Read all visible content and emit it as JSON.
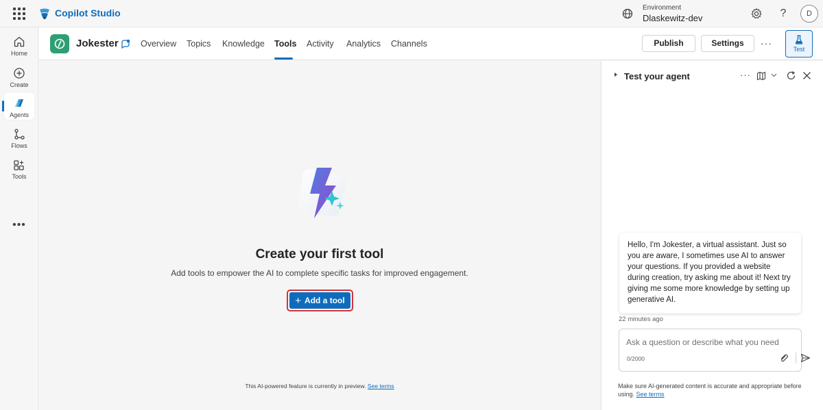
{
  "topbar": {
    "app_name": "Copilot Studio",
    "environment_label": "Environment",
    "environment_value": "Dlaskewitz-dev",
    "avatar_initial": "D",
    "help_glyph": "?",
    "icons": [
      "app-launcher-icon",
      "environment-icon",
      "settings-gear-icon",
      "help-icon"
    ]
  },
  "rail": {
    "items": [
      {
        "label": "Home",
        "icon": "home-icon"
      },
      {
        "label": "Create",
        "icon": "create-plus-icon"
      },
      {
        "label": "Agents",
        "icon": "agents-icon",
        "active": true
      },
      {
        "label": "Flows",
        "icon": "flows-icon"
      },
      {
        "label": "Tools",
        "icon": "tools-icon"
      }
    ],
    "more": "•••"
  },
  "header": {
    "agent_name": "Jokester",
    "tabs": [
      "Overview",
      "Topics",
      "Knowledge",
      "Tools",
      "Activity",
      "Analytics",
      "Channels"
    ],
    "active_tab": "Tools",
    "publish_label": "Publish",
    "settings_label": "Settings",
    "more_label": "···",
    "test_label": "Test"
  },
  "main": {
    "title": "Create your first tool",
    "description": "Add tools to empower the AI to complete specific tasks for improved engagement.",
    "add_button": "Add a tool",
    "add_button_glyph": "+",
    "preview_note": "This AI-powered feature is currently in preview.",
    "preview_link": "See terms"
  },
  "panel": {
    "title": "Test your agent",
    "more_glyph": "···",
    "bot_message": "Hello, I'm Jokester, a virtual assistant. Just so you are aware, I sometimes use AI to answer your questions. If you provided a website during creation, try asking me about it! Next try giving me some more knowledge by setting up generative AI.",
    "message_time": "22 minutes ago",
    "input_placeholder": "Ask a question or describe what you need",
    "char_count": "0/2000",
    "disclaimer": "Make sure AI-generated content is accurate and appropriate before using.",
    "disclaimer_link": "See terms"
  },
  "colors": {
    "accent": "#0f6cbd",
    "agent_logo": "#2f9e73",
    "highlight_border": "#d13438"
  }
}
